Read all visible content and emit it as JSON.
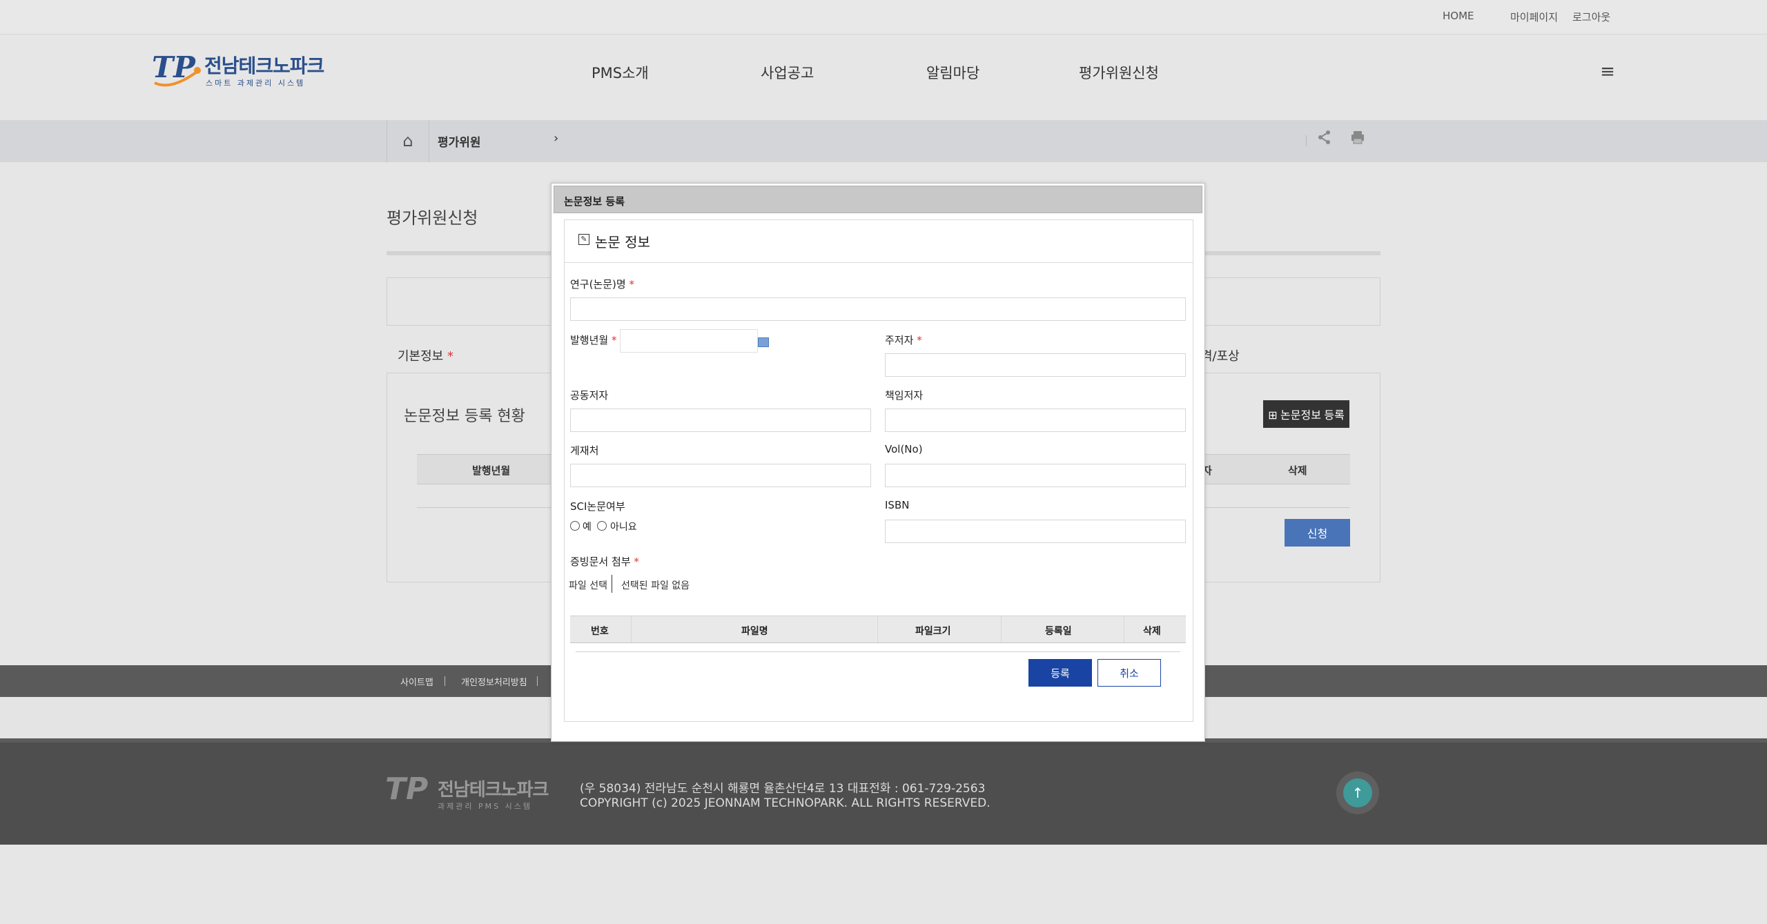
{
  "topbar": {
    "home": "HOME",
    "mypage": "마이페이지",
    "logout": "로그아웃"
  },
  "header": {
    "logo_mark": "TP",
    "logo_text": "전남테크노파크",
    "logo_sub": "스마트 과제관리 시스템",
    "nav": [
      "PMS소개",
      "사업공고",
      "알림마당",
      "평가위원신청"
    ],
    "menu_icon": "hamburger-icon"
  },
  "breadcrumb": {
    "home_icon": "home-icon",
    "label": "평가위원",
    "arrow": "›",
    "share_icon": "share-icon",
    "print_icon": "print-icon"
  },
  "page": {
    "title": "평가위원신청",
    "section_left": "기본정보",
    "section_right_partial": "격/포상",
    "required_mark": "*",
    "list_title": "논문정보 등록 현황",
    "register_button": "⊞ 논문정보 등록",
    "table_headers": {
      "col1": "발행년월",
      "col_partial": "자",
      "col_last": "삭제"
    },
    "apply_button": "신청"
  },
  "footer_band": {
    "links": [
      "사이트맵",
      "개인정보처리방침"
    ]
  },
  "footer": {
    "logo_mark": "TP",
    "logo_text": "전남테크노파크",
    "logo_sub": "과제관리 PMS 시스템",
    "address": "(우 58034) 전라남도 순천시 해룡면 율촌산단4로 13    대표전화 : 061-729-2563",
    "copyright": "COPYRIGHT (c) 2025 JEONNAM TECHNOPARK. ALL RIGHTS RESERVED.",
    "top_button": "↑"
  },
  "modal": {
    "title": "논문정보 등록",
    "section_title": "논문 정보",
    "fields": {
      "research_name": {
        "label": "연구(논문)명",
        "value": ""
      },
      "publish_date": {
        "label": "발행년월",
        "value": ""
      },
      "main_author": {
        "label": "주저자",
        "value": ""
      },
      "co_author": {
        "label": "공동저자",
        "value": ""
      },
      "corresponding_author": {
        "label": "책임저자",
        "value": ""
      },
      "journal": {
        "label": "게재처",
        "value": ""
      },
      "vol": {
        "label": "Vol(No)",
        "value": ""
      },
      "sci": {
        "label": "SCI논문여부",
        "yes": "예",
        "no": "아니요"
      },
      "isbn": {
        "label": "ISBN",
        "value": ""
      },
      "attachment": {
        "label": "증빙문서 첨부",
        "file_button": "파일 선택",
        "no_file": "선택된 파일 없음"
      }
    },
    "file_table_headers": [
      "번호",
      "파일명",
      "파일크기",
      "등록일",
      "삭제"
    ],
    "ok_button": "등록",
    "cancel_button": "취소"
  }
}
